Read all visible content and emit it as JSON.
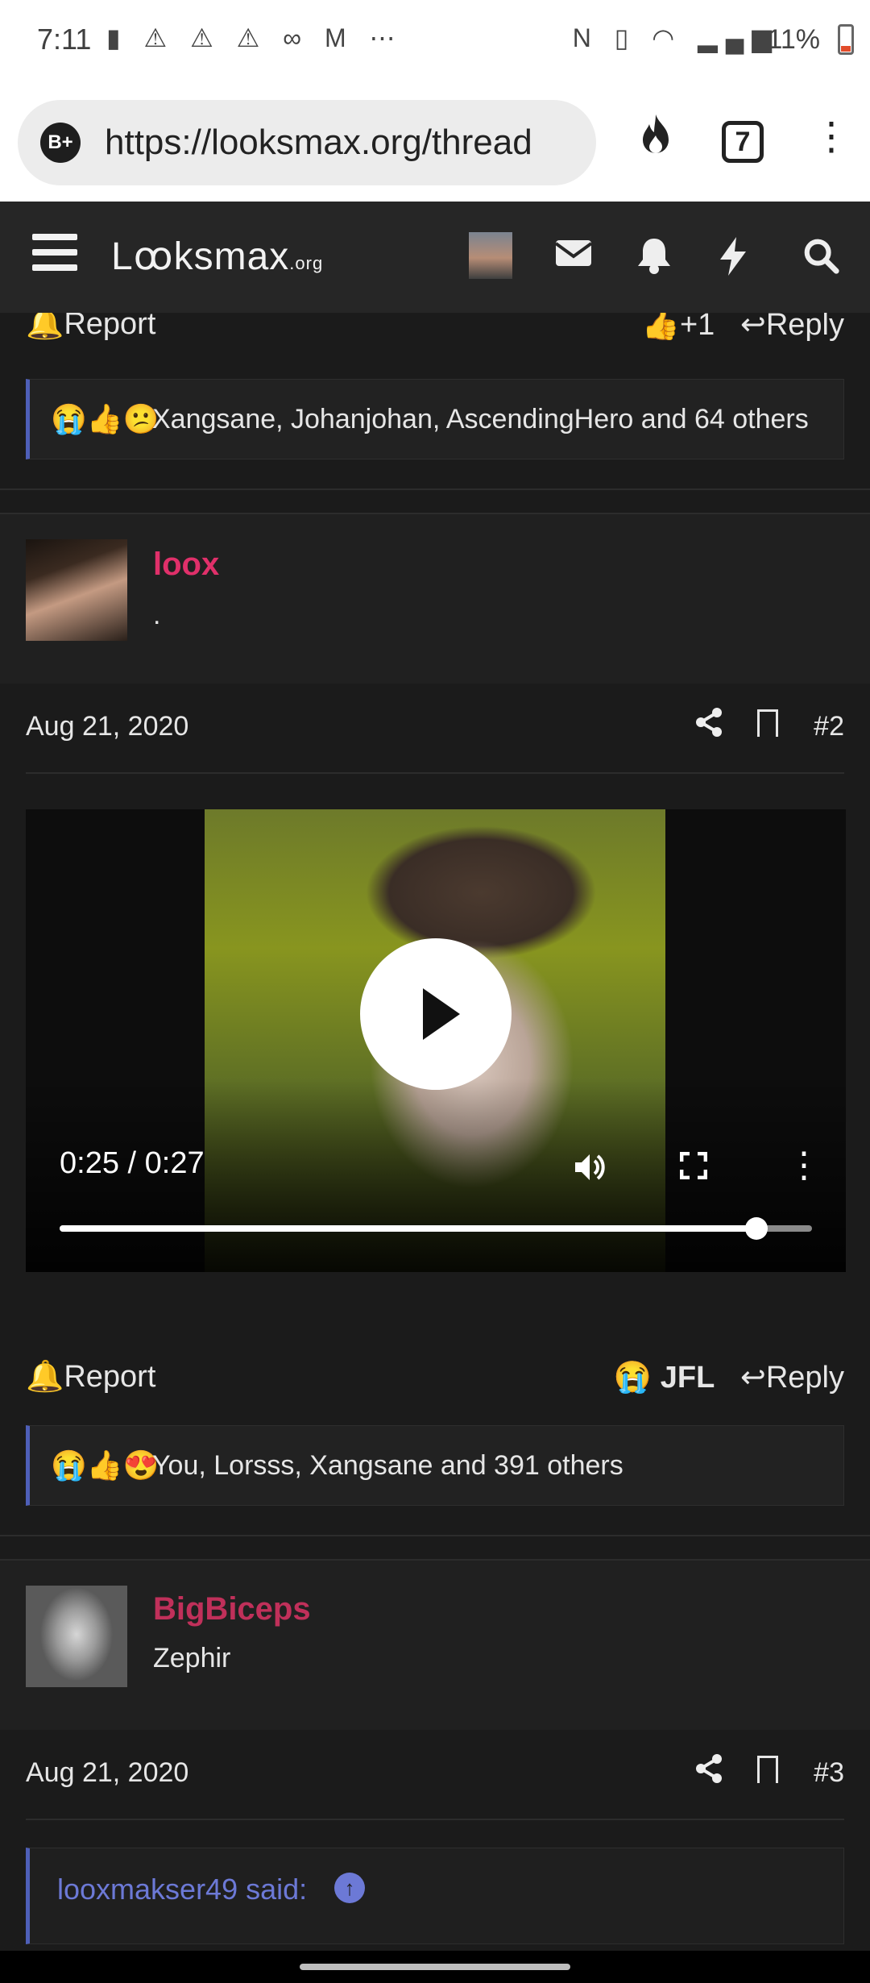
{
  "status_bar": {
    "time": "7:11",
    "left_icons": "▮ ⚠ ⚠ ⚠ ∞ M ⋯",
    "right_icons": "N ▯ ◠ ▂▄▆",
    "battery": "11%"
  },
  "browser": {
    "site_badge": "B+",
    "url": "https://looksmax.org/thread",
    "tab_count": "7"
  },
  "header": {
    "logo_main": "Lꝏksmax",
    "logo_suffix": ".org",
    "icons": [
      "menu-icon",
      "avatar",
      "mail-icon",
      "bell-icon",
      "bolt-icon",
      "search-icon"
    ]
  },
  "post1": {
    "report": "Report",
    "reaction_action": "+1",
    "reply": "Reply",
    "reaction_emojis": "😭👍😕",
    "reactions_text": "Xangsane, Johanjohan, AscendingHero and 64 others"
  },
  "post2": {
    "username": "loox",
    "user_title": ".",
    "username_color": "#e0306a",
    "date": "Aug 21, 2020",
    "post_number": "#2",
    "video": {
      "current_time": "0:25",
      "duration": "0:27",
      "time_display": "0:25 / 0:27",
      "progress_fraction": 0.926
    },
    "report": "Report",
    "reaction_emoji": "😭",
    "reaction_label": "JFL",
    "reply": "Reply",
    "reaction_emojis": "😭👍😍",
    "reactions_text": "You, Lorsss, Xangsane and 391 others"
  },
  "post3": {
    "username": "BigBiceps",
    "user_title": "Zephir",
    "username_color": "#c0305a",
    "date": "Aug 21, 2020",
    "post_number": "#3",
    "quote_author": "looxmakser49 said:"
  }
}
